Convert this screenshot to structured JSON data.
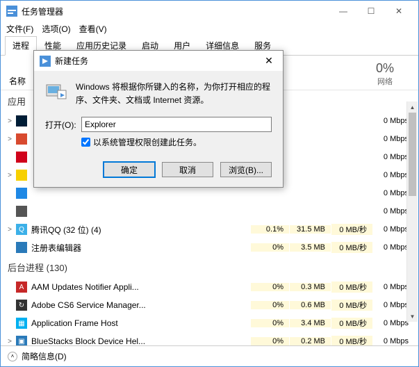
{
  "window": {
    "title": "任务管理器",
    "controls": {
      "min": "—",
      "max": "☐",
      "close": "✕"
    }
  },
  "menu": {
    "file": "文件(F)",
    "options": "选项(O)",
    "view": "查看(V)"
  },
  "tabs": {
    "items": [
      "进程",
      "性能",
      "应用历史记录",
      "启动",
      "用户",
      "详细信息",
      "服务"
    ],
    "active": 0
  },
  "columns": {
    "name": "名称",
    "net_pct": "0%",
    "net_label": "网络"
  },
  "groups": {
    "apps": "应用",
    "bg": "后台进程 (130)"
  },
  "processes": [
    {
      "expand": ">",
      "icon_bg": "#001d36",
      "icon_fg": "#fff",
      "name": "",
      "cpu": "",
      "mem": "",
      "disk": "",
      "net": "0 Mbps"
    },
    {
      "expand": ">",
      "icon_bg": "#d84a2f",
      "icon_fg": "#fff",
      "name": "",
      "cpu": "",
      "mem": "",
      "disk": "",
      "net": "0 Mbps"
    },
    {
      "expand": "",
      "icon_bg": "#d0021b",
      "icon_fg": "#fff",
      "name": "",
      "cpu": "",
      "mem": "",
      "disk": "",
      "net": "0 Mbps"
    },
    {
      "expand": ">",
      "icon_bg": "#f7d000",
      "icon_fg": "#000",
      "name": "",
      "cpu": "",
      "mem": "",
      "disk": "",
      "net": "0 Mbps"
    },
    {
      "expand": "",
      "icon_bg": "#1e88e5",
      "icon_fg": "#fff",
      "name": "",
      "cpu": "",
      "mem": "",
      "disk": "",
      "net": "0 Mbps"
    },
    {
      "expand": "",
      "icon_bg": "#555",
      "icon_fg": "#fff",
      "name": "",
      "cpu": "",
      "mem": "",
      "disk": "",
      "net": "0 Mbps"
    },
    {
      "expand": ">",
      "icon_bg": "#3cb0e8",
      "icon_fg": "#fff",
      "icon_glyph": "Q",
      "name": "腾讯QQ (32 位) (4)",
      "cpu": "0.1%",
      "mem": "31.5 MB",
      "disk": "0 MB/秒",
      "net": "0 Mbps"
    },
    {
      "expand": "",
      "icon_bg": "#2a7ab9",
      "icon_fg": "#fff",
      "name": "注册表编辑器",
      "cpu": "0%",
      "mem": "3.5 MB",
      "disk": "0 MB/秒",
      "net": "0 Mbps"
    }
  ],
  "bg_processes": [
    {
      "expand": "",
      "icon_bg": "#c62828",
      "icon_fg": "#fff",
      "icon_glyph": "A",
      "name": "AAM Updates Notifier Appli...",
      "cpu": "0%",
      "mem": "0.3 MB",
      "disk": "0 MB/秒",
      "net": "0 Mbps"
    },
    {
      "expand": "",
      "icon_bg": "#333",
      "icon_fg": "#fff",
      "icon_glyph": "↻",
      "name": "Adobe CS6 Service Manager...",
      "cpu": "0%",
      "mem": "0.6 MB",
      "disk": "0 MB/秒",
      "net": "0 Mbps"
    },
    {
      "expand": "",
      "icon_bg": "#00b0f0",
      "icon_fg": "#fff",
      "icon_glyph": "▦",
      "name": "Application Frame Host",
      "cpu": "0%",
      "mem": "3.4 MB",
      "disk": "0 MB/秒",
      "net": "0 Mbps"
    },
    {
      "expand": ">",
      "icon_bg": "#2a7ab9",
      "icon_fg": "#fff",
      "icon_glyph": "▣",
      "name": "BlueStacks Block Device Hel...",
      "cpu": "0%",
      "mem": "0.2 MB",
      "disk": "0 MB/秒",
      "net": "0 Mbps"
    }
  ],
  "footer": {
    "label": "简略信息(D)"
  },
  "dialog": {
    "title": "新建任务",
    "message": "Windows 将根据你所键入的名称，为你打开相应的程序、文件夹、文档或 Internet 资源。",
    "open_label": "打开(O):",
    "input_value": "Explorer",
    "checkbox": "以系统管理权限创建此任务。",
    "ok": "确定",
    "cancel": "取消",
    "browse": "浏览(B)..."
  }
}
